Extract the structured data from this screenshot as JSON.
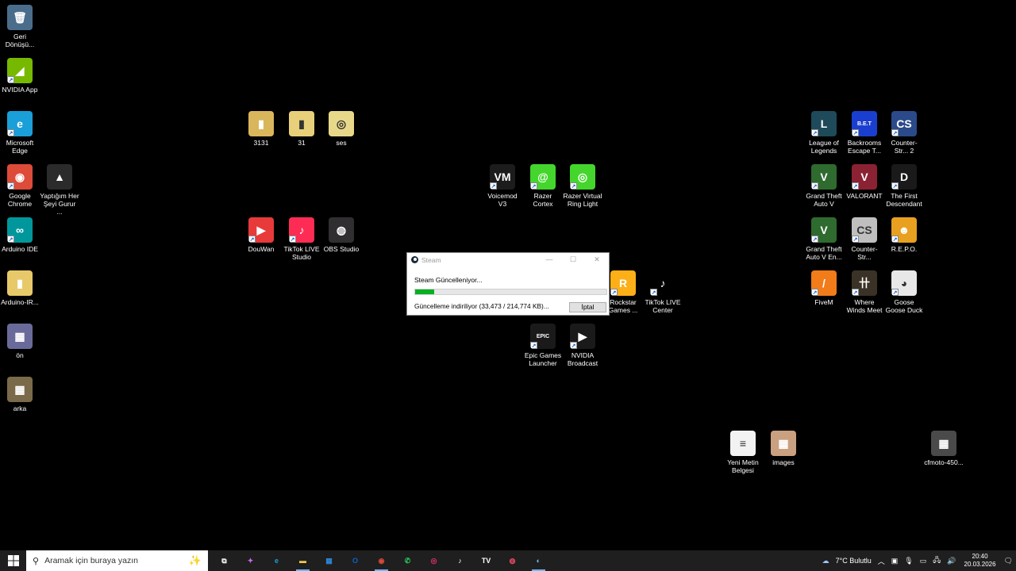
{
  "desktop": {
    "icons": [
      {
        "label": "Geri Dönüşü...",
        "glyph": "🗑",
        "color": "#4a6d8c",
        "shortcut": false
      },
      {
        "label": "NVIDIA App",
        "glyph": "◢",
        "color": "#76b900",
        "shortcut": true
      },
      {
        "label": "Microsoft Edge",
        "glyph": "e",
        "color": "#1a9fd8",
        "shortcut": true
      },
      {
        "label": "Google Chrome",
        "glyph": "◉",
        "color": "#dd4b39",
        "shortcut": true
      },
      {
        "label": "Yaptığım Her Şeyi Gurur ...",
        "glyph": "▲",
        "color": "#2b2b2b",
        "shortcut": false
      },
      {
        "label": "Arduino IDE",
        "glyph": "∞",
        "color": "#00979c",
        "shortcut": true
      },
      {
        "label": "Arduino-IR...",
        "glyph": "▮",
        "color": "#e8c96a",
        "shortcut": false
      },
      {
        "label": "ön",
        "glyph": "▦",
        "color": "#6a6a9a",
        "shortcut": false
      },
      {
        "label": "arka",
        "glyph": "▦",
        "color": "#7a6a4a",
        "shortcut": false
      },
      {
        "label": "3131",
        "glyph": "▮",
        "color": "#d9b65c",
        "shortcut": false
      },
      {
        "label": "31",
        "glyph": "▮",
        "color": "#e8cf7a",
        "shortcut": false
      },
      {
        "label": "ses",
        "glyph": "◎",
        "color": "#e8d98a",
        "shortcut": false
      },
      {
        "label": "DouWan",
        "glyph": "▶",
        "color": "#e83a3a",
        "shortcut": true
      },
      {
        "label": "TikTok LIVE Studio",
        "glyph": "♪",
        "color": "#fe2c55",
        "shortcut": true
      },
      {
        "label": "OBS Studio",
        "glyph": "◍",
        "color": "#302e31",
        "shortcut": false
      },
      {
        "label": "Voicemod V3",
        "glyph": "VM",
        "color": "#1c1c1c",
        "shortcut": true
      },
      {
        "label": "Razer Cortex",
        "glyph": "@",
        "color": "#44d62c",
        "shortcut": true
      },
      {
        "label": "Razer Virtual Ring Light",
        "glyph": "◎",
        "color": "#44d62c",
        "shortcut": true
      },
      {
        "label": "Rockstar Games ...",
        "glyph": "R",
        "color": "#fcaf17",
        "shortcut": true
      },
      {
        "label": "TikTok LIVE Center",
        "glyph": "♪",
        "color": "#000000",
        "shortcut": true
      },
      {
        "label": "Epic Games Launcher",
        "glyph": "EPIC",
        "color": "#1a1a1a",
        "shortcut": true
      },
      {
        "label": "NVIDIA Broadcast",
        "glyph": "▶",
        "color": "#1a1a1a",
        "shortcut": true
      },
      {
        "label": "League of Legends",
        "glyph": "L",
        "color": "#1e4a5a",
        "shortcut": true
      },
      {
        "label": "Backrooms Escape T...",
        "glyph": "B.E.T",
        "color": "#1a3fd0",
        "shortcut": true
      },
      {
        "label": "Counter-Str... 2",
        "glyph": "CS",
        "color": "#2a4a8a",
        "shortcut": true
      },
      {
        "label": "Grand Theft Auto V",
        "glyph": "V",
        "color": "#2f6a2f",
        "shortcut": true
      },
      {
        "label": "VALORANT",
        "glyph": "V",
        "color": "#8a2233",
        "shortcut": true
      },
      {
        "label": "The First Descendant",
        "glyph": "D",
        "color": "#1a1a1a",
        "shortcut": true
      },
      {
        "label": "Grand Theft Auto V En...",
        "glyph": "V",
        "color": "#2f6a2f",
        "shortcut": true
      },
      {
        "label": "Counter-Str...",
        "glyph": "CS",
        "color": "#bfbfbf",
        "shortcut": true
      },
      {
        "label": "R.E.P.O.",
        "glyph": "☻",
        "color": "#e8a020",
        "shortcut": true
      },
      {
        "label": "FiveM",
        "glyph": "/",
        "color": "#f27b1a",
        "shortcut": true
      },
      {
        "label": "Where Winds Meet",
        "glyph": "卄",
        "color": "#3a3226",
        "shortcut": true
      },
      {
        "label": "Goose Goose Duck",
        "glyph": "◕",
        "color": "#e8e8e8",
        "shortcut": true
      },
      {
        "label": "Yeni Metin Belgesi",
        "glyph": "≡",
        "color": "#f2f2f2",
        "shortcut": false
      },
      {
        "label": "images",
        "glyph": "▦",
        "color": "#c9a080",
        "shortcut": false
      },
      {
        "label": "cfmoto-450...",
        "glyph": "▦",
        "color": "#4a4a4a",
        "shortcut": false
      }
    ]
  },
  "steam_dialog": {
    "title": "Steam",
    "minimize": "—",
    "maximize": "☐",
    "close": "✕",
    "message": "Steam Güncelleniyor...",
    "detail": "Güncelleme indiriliyor (33,473 / 214,774 KB)...",
    "cancel_label": "İptal",
    "progress": 0.1,
    "progress_color": "#06b025"
  },
  "taskbar": {
    "search_placeholder": "Aramak için buraya yazın",
    "apps": [
      {
        "name": "task-view",
        "glyph": "⧉",
        "color": "#ffffff"
      },
      {
        "name": "copilot",
        "glyph": "✦",
        "color": "#c86bf0"
      },
      {
        "name": "edge",
        "glyph": "e",
        "color": "#1a9fd8"
      },
      {
        "name": "file-explorer",
        "glyph": "▬",
        "color": "#f2c94c"
      },
      {
        "name": "store",
        "glyph": "▦",
        "color": "#2b88d8"
      },
      {
        "name": "outlook",
        "glyph": "O",
        "color": "#0a64c8"
      },
      {
        "name": "chrome",
        "glyph": "◉",
        "color": "#dd4b39"
      },
      {
        "name": "whatsapp",
        "glyph": "✆",
        "color": "#25d366"
      },
      {
        "name": "instagram",
        "glyph": "◎",
        "color": "#e1306c"
      },
      {
        "name": "tiktok",
        "glyph": "♪",
        "color": "#ffffff"
      },
      {
        "name": "tradingview",
        "glyph": "TV",
        "color": "#ffffff"
      },
      {
        "name": "razer",
        "glyph": "◍",
        "color": "#e84a5f"
      },
      {
        "name": "steam",
        "glyph": "◐",
        "color": "#66c0f4"
      }
    ],
    "weather": "7°C Bulutlu",
    "time": "20:40",
    "date": "20.03.2026"
  }
}
